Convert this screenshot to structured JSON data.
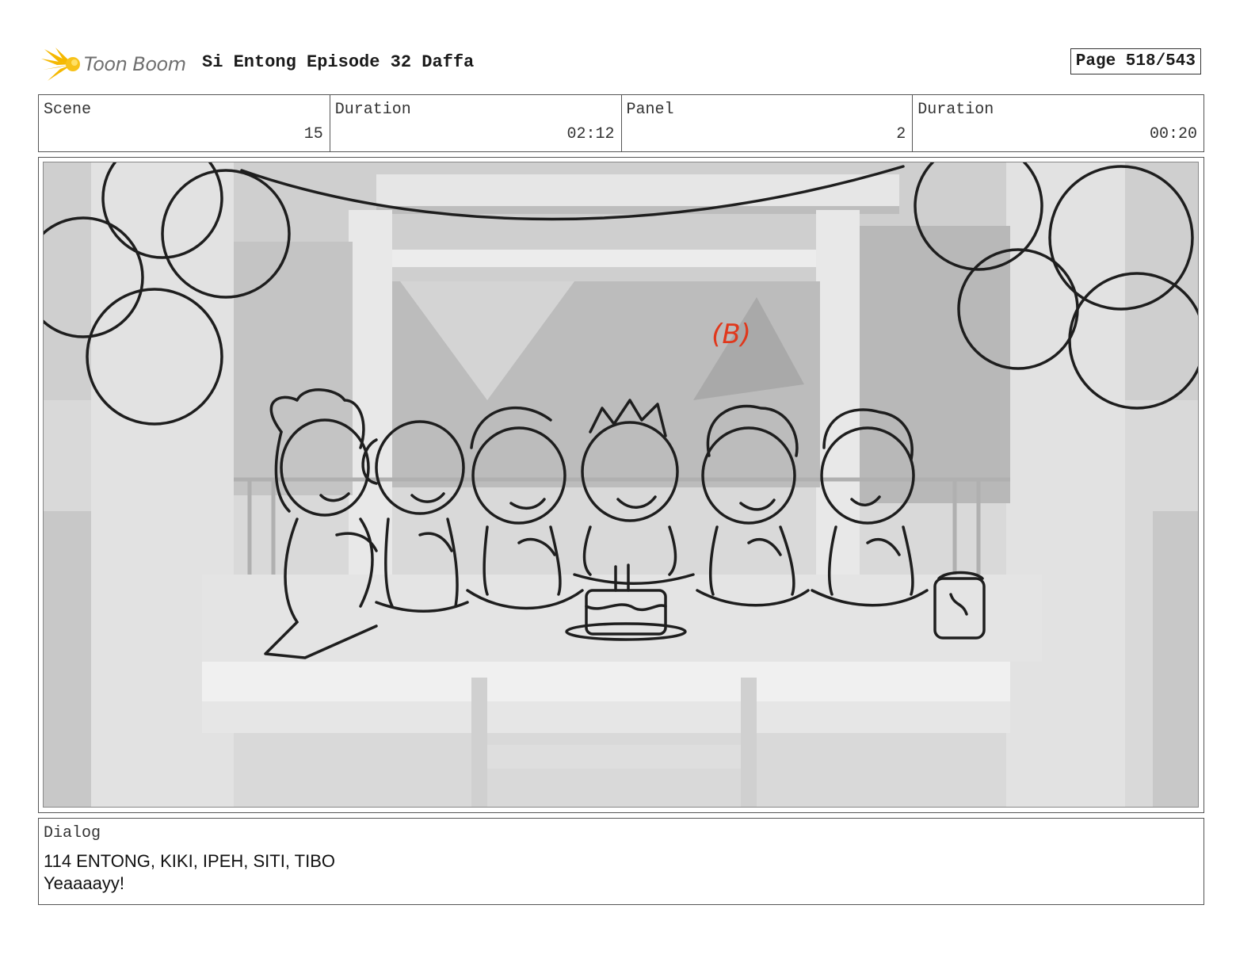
{
  "header": {
    "logo_text": "Toon Boom",
    "title": "Si Entong Episode 32 Daffa",
    "page": "Page 518/543"
  },
  "info": {
    "scene_label": "Scene",
    "scene_value": "15",
    "scene_duration_label": "Duration",
    "scene_duration_value": "02:12",
    "panel_label": "Panel",
    "panel_value": "2",
    "panel_duration_label": "Duration",
    "panel_duration_value": "00:20"
  },
  "panel": {
    "annotation_mark": "B",
    "annotation_color": "#e0381c"
  },
  "dialog": {
    "label": "Dialog",
    "line1": "114 ENTONG, KIKI, IPEH, SITI, TIBO",
    "line2": "Yeaaaayy!"
  },
  "icons": {
    "logo": "toon-boom-star-icon"
  }
}
